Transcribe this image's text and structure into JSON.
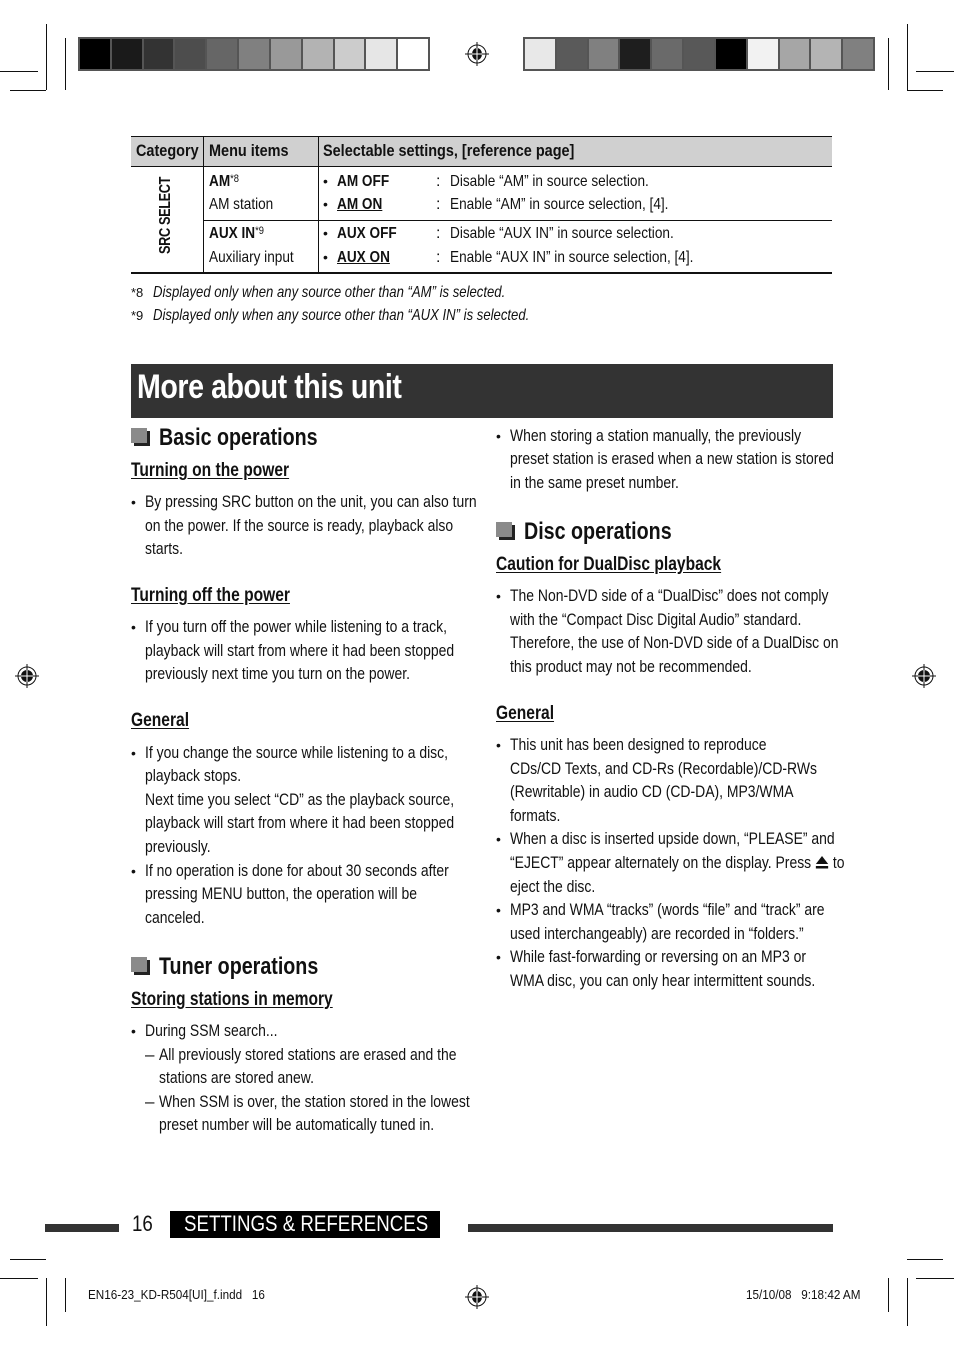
{
  "color_bars": {
    "left": [
      "#000000",
      "#1a1a1a",
      "#333333",
      "#4d4d4d",
      "#666666",
      "#808080",
      "#999999",
      "#b3b3b3",
      "#cccccc",
      "#e6e6e6",
      "#ffffff"
    ],
    "right": [
      "#e8e8e8",
      "#5a5a5a",
      "#808080",
      "#1e1e1e",
      "#6a6a6a",
      "#585858",
      "#000000",
      "#f2f2f2",
      "#a6a6a6",
      "#b4b4b4",
      "#808080"
    ]
  },
  "table": {
    "headers": [
      "Category",
      "Menu items",
      "Selectable settings, [reference page]"
    ],
    "category": "SRC SELECT",
    "rows": [
      {
        "item": "AM",
        "note_ref": "*8",
        "item_desc": "AM station",
        "settings": [
          {
            "name": "AM OFF",
            "default": false,
            "desc": "Disable “AM” in source selection."
          },
          {
            "name": "AM ON",
            "default": true,
            "desc": "Enable “AM” in source selection, [4]."
          }
        ]
      },
      {
        "item": "AUX IN",
        "note_ref": "*9",
        "item_desc": "Auxiliary input",
        "settings": [
          {
            "name": "AUX OFF",
            "default": false,
            "desc": "Disable “AUX IN” in source selection."
          },
          {
            "name": "AUX ON",
            "default": true,
            "desc": "Enable “AUX IN” in source selection, [4]."
          }
        ]
      }
    ],
    "colon": ":",
    "bullet": "•"
  },
  "footnotes": [
    {
      "mark": "*8",
      "text": "Displayed only when any source other than “AM” is selected."
    },
    {
      "mark": "*9",
      "text": "Displayed only when any source other than “AUX IN” is selected."
    }
  ],
  "banner": {
    "title": "More about this unit"
  },
  "left_col": {
    "basic": {
      "title": "Basic operations",
      "turning_on": {
        "title": "Turning on the power",
        "lines": [
          "By pressing SRC button on the unit, you can also turn",
          "on the power. If the source is ready, playback also",
          "starts."
        ]
      },
      "turning_off": {
        "title": "Turning off the power",
        "lines": [
          "If you turn off the power while listening to a track,",
          "playback will start from where it had been stopped",
          "previously next time you turn on the power."
        ]
      },
      "general": {
        "title": "General",
        "item1": [
          "If you change the source while listening to a disc,",
          "playback stops.",
          "Next time you select “CD” as the playback source,",
          "playback will start from where it had been stopped",
          "previously."
        ],
        "item2": [
          "If no operation is done for about 30 seconds after",
          "pressing MENU button, the operation will be",
          "canceled."
        ]
      }
    },
    "tuner": {
      "title": "Tuner operations",
      "storing": {
        "title": "Storing stations in memory",
        "lead": "During SSM search...",
        "dash": "–",
        "sub1": [
          "All previously stored stations are erased and the",
          "stations are stored anew."
        ],
        "sub2": [
          "When SSM is over, the station stored in the lowest",
          "preset number will be automatically tuned in."
        ]
      }
    }
  },
  "right_col": {
    "manual_store": [
      "When storing a station manually, the previously",
      "preset station is erased when a new station is stored",
      "in the same preset number."
    ],
    "disc": {
      "title": "Disc operations",
      "caution": {
        "title": "Caution for DualDisc playback",
        "lines": [
          "The Non-DVD side of a “DualDisc” does not comply",
          "with the “Compact Disc Digital Audio” standard.",
          "Therefore, the use of Non-DVD side of a DualDisc on",
          "this product may not be recommended."
        ]
      },
      "general": {
        "title": "General",
        "item1": [
          "This unit has been designed to reproduce",
          "CDs/CD Texts, and CD-Rs (Recordable)/CD-RWs",
          "(Rewritable) in audio CD (CD-DA), MP3/WMA",
          "formats."
        ],
        "item2_a": [
          "When a disc is inserted upside down, “PLEASE” and"
        ],
        "item2_b_pre": "“EJECT” appear alternately on the display. Press",
        "item2_b_post": "to",
        "item2_c": "eject the disc.",
        "item3": [
          "MP3 and WMA “tracks” (words “file” and “track” are",
          "used interchangeably) are recorded in “folders.”"
        ],
        "item4": [
          "While fast-forwarding or reversing on an MP3 or",
          "WMA disc, you can only hear intermittent sounds."
        ]
      }
    }
  },
  "footer": {
    "page_number": "16",
    "section": "SETTINGS & REFERENCES",
    "file_info": "EN16-23_KD-R504[UI]_f.indd   16",
    "timestamp": "15/10/08   9:18:42 AM"
  }
}
